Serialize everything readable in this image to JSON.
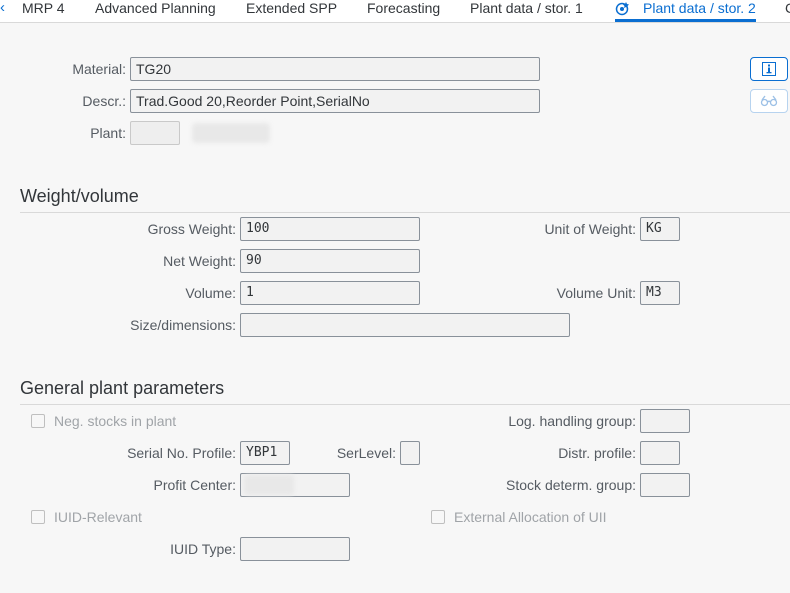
{
  "tabs": [
    {
      "label": "MRP 4"
    },
    {
      "label": "Advanced Planning"
    },
    {
      "label": "Extended SPP"
    },
    {
      "label": "Forecasting"
    },
    {
      "label": "Plant data / stor. 1"
    },
    {
      "label": "Plant data / stor. 2",
      "active": true
    },
    {
      "label": "C"
    }
  ],
  "header": {
    "material_label": "Material:",
    "material_value": "TG20",
    "descr_label": "Descr.:",
    "descr_value": "Trad.Good 20,Reorder Point,SerialNo",
    "plant_label": "Plant:"
  },
  "weight_volume": {
    "title": "Weight/volume",
    "gross_weight_label": "Gross Weight:",
    "gross_weight_value": "100",
    "net_weight_label": "Net Weight:",
    "net_weight_value": "90",
    "volume_label": "Volume:",
    "volume_value": "1",
    "size_label": "Size/dimensions:",
    "size_value": "",
    "unit_weight_label": "Unit of Weight:",
    "unit_weight_value": "KG",
    "volume_unit_label": "Volume Unit:",
    "volume_unit_value": "M3"
  },
  "general": {
    "title": "General plant parameters",
    "neg_stocks_label": "Neg. stocks in plant",
    "log_handling_label": "Log. handling group:",
    "serial_profile_label": "Serial No. Profile:",
    "serial_profile_value": "YBP1",
    "serlevel_label": "SerLevel:",
    "distr_profile_label": "Distr. profile:",
    "profit_center_label": "Profit Center:",
    "stock_determ_label": "Stock determ. group:",
    "iuid_relevant_label": "IUID-Relevant",
    "external_alloc_label": "External Allocation of UII",
    "iuid_type_label": "IUID Type:"
  },
  "icons": {
    "nav_left": "chevron-left-icon",
    "active_tab": "target-icon",
    "info": "info-icon",
    "where_used": "glasses-icon"
  },
  "colors": {
    "accent": "#0a6ed1",
    "background": "#f7f7f7",
    "field_border": "#89919a"
  }
}
